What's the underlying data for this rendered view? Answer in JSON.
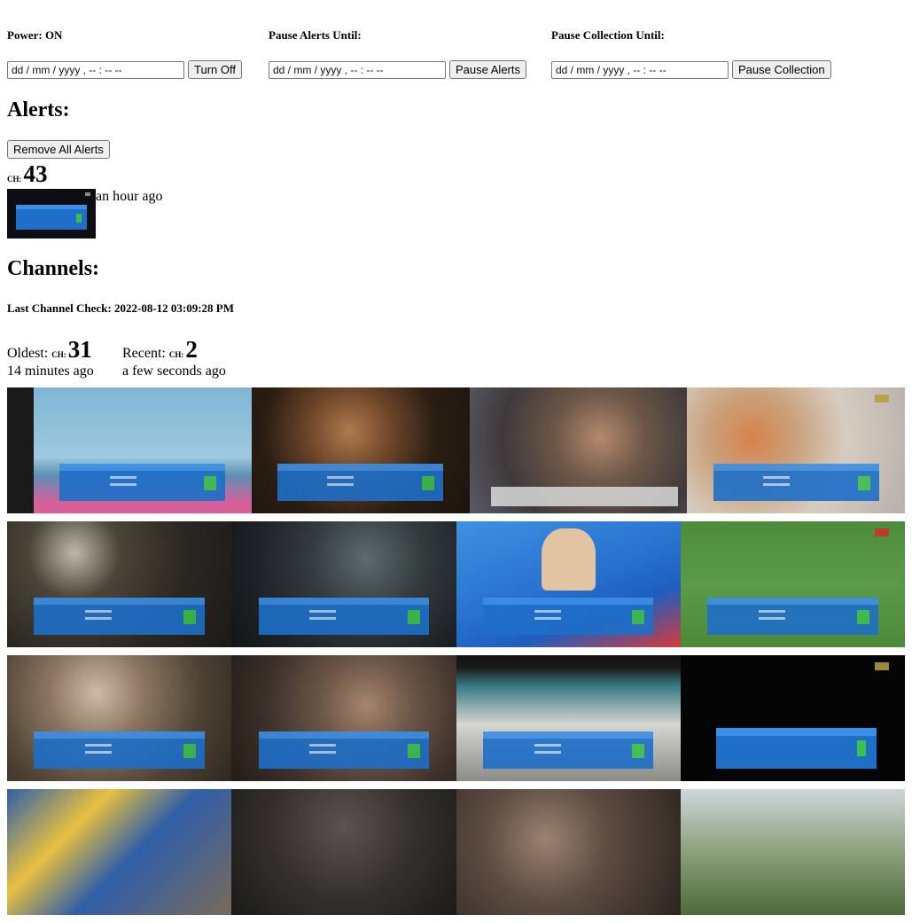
{
  "controls": {
    "power": {
      "label": "Power: ON",
      "date_placeholder": "dd / mm / yyyy ,  -- : --   --",
      "button": "Turn Off"
    },
    "alerts_pause": {
      "label": "Pause Alerts Until:",
      "date_placeholder": "dd / mm / yyyy ,  -- : --   --",
      "button": "Pause Alerts"
    },
    "collection_pause": {
      "label": "Pause Collection Until:",
      "date_placeholder": "dd / mm / yyyy ,  -- : --   --",
      "button": "Pause Collection"
    }
  },
  "alerts": {
    "heading": "Alerts:",
    "remove_all": "Remove All Alerts",
    "items": [
      {
        "ch_prefix": "CH:",
        "channel": "43",
        "time": "an hour ago"
      }
    ]
  },
  "channels": {
    "heading": "Channels:",
    "last_check": "Last Channel Check: 2022-08-12 03:09:28 PM",
    "oldest": {
      "label": "Oldest:",
      "ch_prefix": "CH:",
      "channel": "31",
      "time": "14 minutes ago"
    },
    "recent": {
      "label": "Recent:",
      "ch_prefix": "CH:",
      "channel": "2",
      "time": "a few seconds ago"
    }
  },
  "colors": {
    "osd_blue": "#1e6fc8",
    "signal_green": "#3cc04a"
  }
}
